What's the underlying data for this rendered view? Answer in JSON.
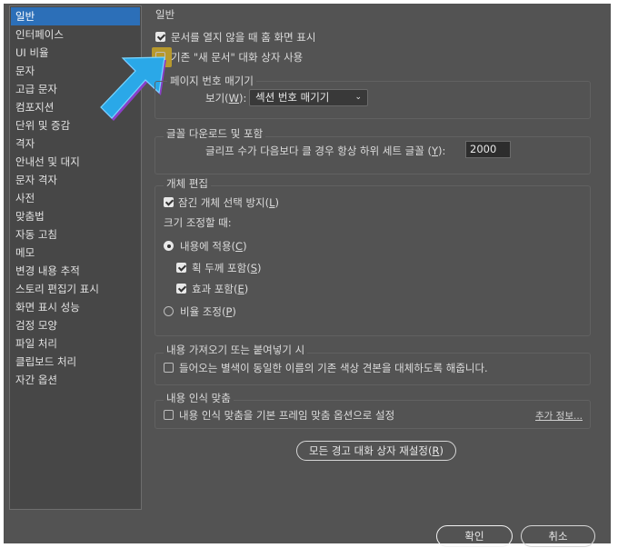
{
  "sidebar": {
    "items": [
      "일반",
      "인터페이스",
      "UI 비율",
      "문자",
      "고급 문자",
      "컴포지션",
      "단위 및 증감",
      "격자",
      "안내선 및 대지",
      "문자 격자",
      "사전",
      "맞춤법",
      "자동 고침",
      "메모",
      "변경 내용 추적",
      "스토리 편집기 표시",
      "화면 표시 성능",
      "검정 모양",
      "파일 처리",
      "클립보드 처리",
      "자간 옵션"
    ],
    "selected": 0
  },
  "general": {
    "title": "일반",
    "show_home": "문서를 열지 않을 때 홈 화면 표시",
    "legacy_new_doc": "기존 \"새 문서\" 대화 상자 사용"
  },
  "page_numbering": {
    "title": "페이지 번호 매기기",
    "view_label": "보기(",
    "view_key": "W",
    "view_suffix": "):",
    "view_value": "섹션 번호 매기기"
  },
  "font_download": {
    "title": "글꼴 다운로드 및 포함",
    "subset_label": "글리프 수가 다음보다 클 경우 항상 하위 세트 글꼴 (",
    "subset_key": "Y",
    "subset_suffix": "):",
    "subset_value": "2000"
  },
  "object_editing": {
    "title": "개체 편집",
    "lock_label": "잠긴 개체 선택 방지(",
    "lock_key": "L",
    "lock_suffix": ")",
    "scaling_label": "크기 조정할 때:",
    "apply_content": "내용에 적용(",
    "apply_content_key": "C",
    "apply_content_suffix": ")",
    "include_stroke": "획 두께 포함(",
    "include_stroke_key": "S",
    "include_stroke_suffix": ")",
    "include_effects": "효과 포함(",
    "include_effects_key": "E",
    "include_effects_suffix": ")",
    "adjust_scale": "비율 조정(",
    "adjust_scale_key": "P",
    "adjust_scale_suffix": ")"
  },
  "import_paste": {
    "title": "내용 가져오기 또는 붙여넣기 시",
    "swatch_label": "들어오는 별색이 동일한 이름의 기존 색상 견본을 대체하도록 해줍니다."
  },
  "content_aware": {
    "title": "내용 인식 맞춤",
    "default_label": "내용 인식 맞춤을 기본 프레임 맞춤 옵션으로 설정",
    "more_info": "추가 정보..."
  },
  "reset_button": {
    "label": "모든 경고 대화 상자 재설정(",
    "key": "R",
    "suffix": ")"
  },
  "footer": {
    "ok": "확인",
    "cancel": "취소"
  },
  "colors": {
    "accent": "#2c6fb8",
    "arrow": "#2aa8e8",
    "highlight": "#d8b020"
  }
}
